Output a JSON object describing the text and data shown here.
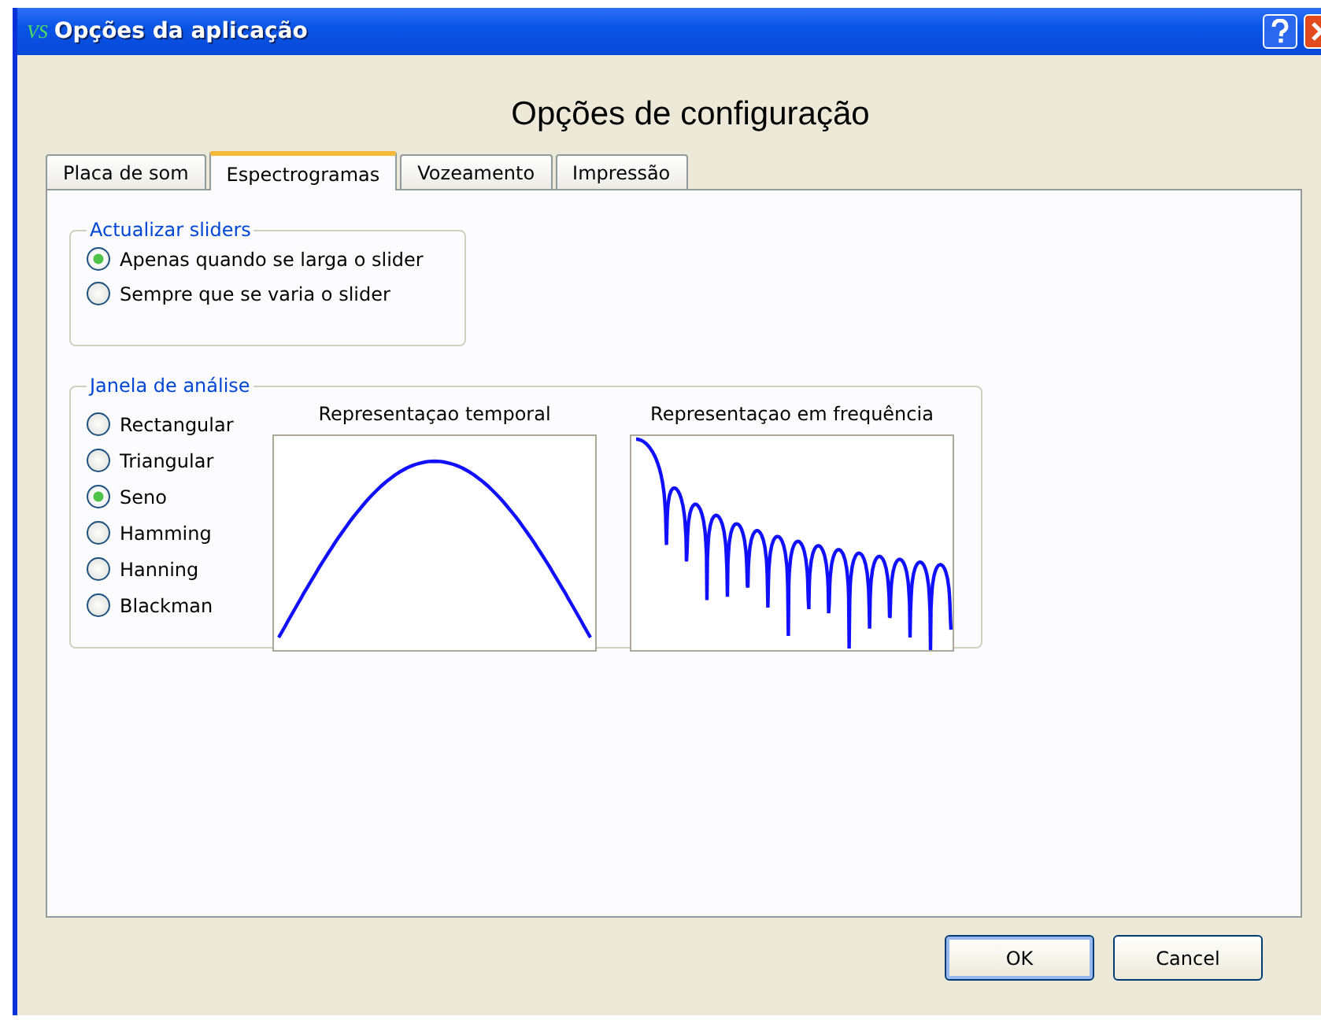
{
  "window": {
    "title": "Opções da aplicação",
    "logo": "VS"
  },
  "heading": "Opções de configuração",
  "tabs": [
    {
      "label": "Placa de som",
      "selected": false
    },
    {
      "label": "Espectrogramas",
      "selected": true
    },
    {
      "label": "Vozeamento",
      "selected": false
    },
    {
      "label": "Impressão",
      "selected": false
    }
  ],
  "update_group": {
    "title": "Actualizar sliders",
    "options": [
      {
        "label": "Apenas quando se larga o slider",
        "selected": true
      },
      {
        "label": "Sempre que se varia o slider",
        "selected": false
      }
    ]
  },
  "window_group": {
    "title": "Janela de análise",
    "options": [
      {
        "label": "Rectangular",
        "selected": false
      },
      {
        "label": "Triangular",
        "selected": false
      },
      {
        "label": "Seno",
        "selected": true
      },
      {
        "label": "Hamming",
        "selected": false
      },
      {
        "label": "Hanning",
        "selected": false
      },
      {
        "label": "Blackman",
        "selected": false
      }
    ],
    "plots": [
      {
        "kind": "time",
        "title": "Representaçao temporal"
      },
      {
        "kind": "frequency",
        "title": "Representaçao em frequência"
      }
    ]
  },
  "buttons": [
    {
      "label": "OK",
      "default": true
    },
    {
      "label": "Cancel",
      "default": false
    }
  ]
}
